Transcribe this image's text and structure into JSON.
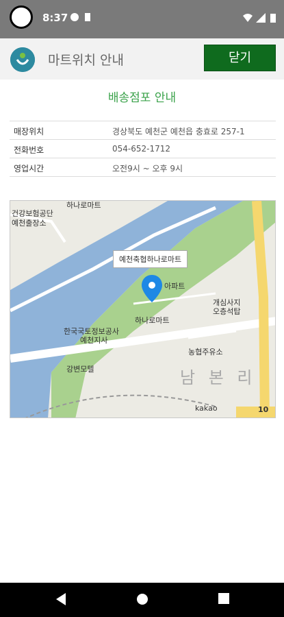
{
  "status_bar": {
    "time": "8:37"
  },
  "app_bar": {
    "title": "마트위치 안내",
    "close_label": "닫기"
  },
  "section_title": "배송점포 안내",
  "info_rows": [
    {
      "label": "매장위치",
      "value": "경상북도 예천군 예천읍 충효로 257-1"
    },
    {
      "label": "전화번호",
      "value": "054-652-1712"
    },
    {
      "label": "영업시간",
      "value": "오전9시 ~ 오후 9시"
    }
  ],
  "map": {
    "marker_label": "예천축협하나로마트",
    "labels": {
      "hanaro_top": "하나로마트",
      "health_office_1": "건강보험공단",
      "health_office_2": "예천출장소",
      "apartment": "아파트",
      "hanaro_mart": "하나로마트",
      "land_info_1": "한국국토정보공사",
      "land_info_2": "예천지사",
      "temple_1": "개심사지",
      "temple_2": "오층석탑",
      "gas_station": "농협주유소",
      "motel": "강변모텔",
      "district": "남 본 리",
      "provider": "kakao",
      "scale": "10"
    }
  }
}
